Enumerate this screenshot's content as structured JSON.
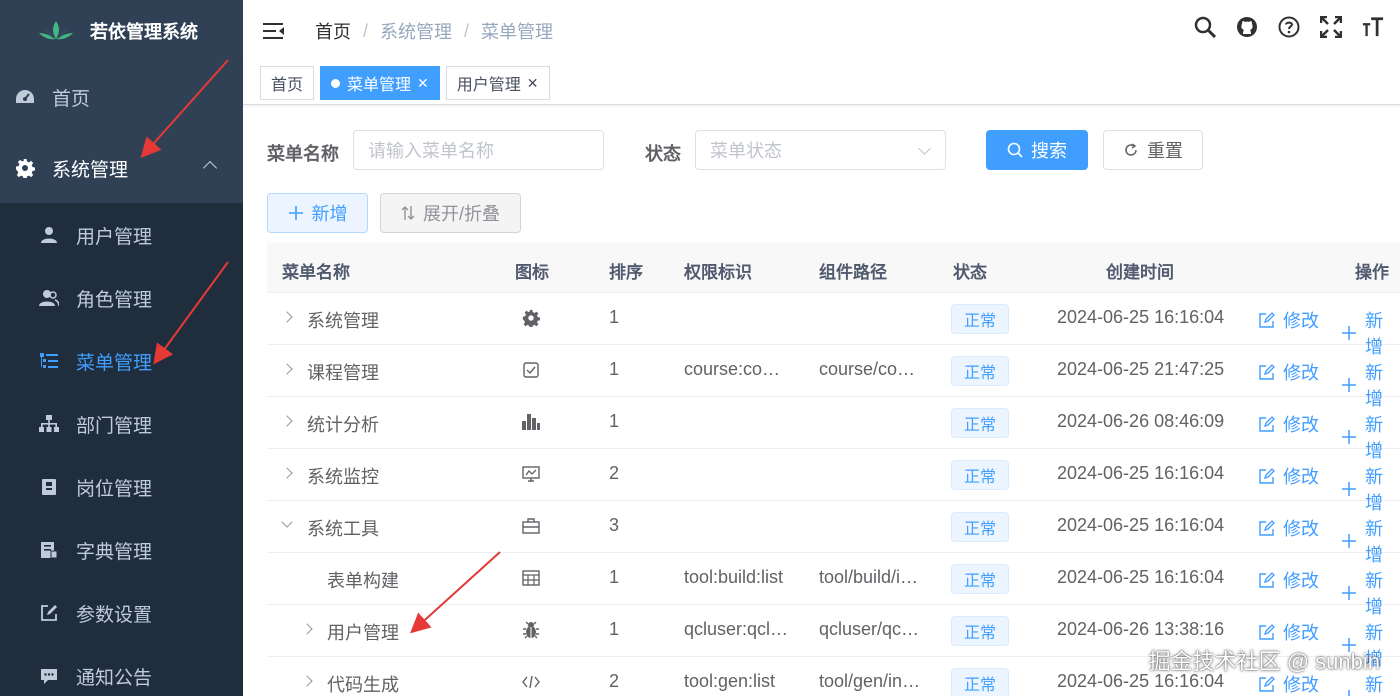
{
  "app": {
    "title": "若依管理系统"
  },
  "sidebar": {
    "items": [
      {
        "label": "首页"
      },
      {
        "label": "系统管理"
      },
      {
        "label": "用户管理"
      },
      {
        "label": "角色管理"
      },
      {
        "label": "菜单管理"
      },
      {
        "label": "部门管理"
      },
      {
        "label": "岗位管理"
      },
      {
        "label": "字典管理"
      },
      {
        "label": "参数设置"
      },
      {
        "label": "通知公告"
      }
    ]
  },
  "breadcrumb": [
    "首页",
    "系统管理",
    "菜单管理"
  ],
  "breadcrumb_sep": "/",
  "tags": [
    {
      "label": "首页"
    },
    {
      "label": "菜单管理"
    },
    {
      "label": "用户管理"
    }
  ],
  "search": {
    "name_label": "菜单名称",
    "name_placeholder": "请输入菜单名称",
    "status_label": "状态",
    "status_placeholder": "菜单状态",
    "search_btn": "搜索",
    "reset_btn": "重置"
  },
  "toolbar": {
    "add_btn": "新增",
    "expand_btn": "展开/折叠"
  },
  "table": {
    "headers": [
      "菜单名称",
      "图标",
      "排序",
      "权限标识",
      "组件路径",
      "状态",
      "创建时间",
      "操作"
    ],
    "rows": [
      {
        "name": "系统管理",
        "icon": "gear-icon",
        "order": "1",
        "perm": "",
        "path": "",
        "status": "正常",
        "created": "2024-06-25 16:16:04",
        "edit": "修改",
        "add": "新增"
      },
      {
        "name": "课程管理",
        "icon": "checkbox-icon",
        "order": "1",
        "perm": "course:co…",
        "path": "course/co…",
        "status": "正常",
        "created": "2024-06-25 21:47:25",
        "edit": "修改",
        "add": "新增"
      },
      {
        "name": "统计分析",
        "icon": "bar-chart-icon",
        "order": "1",
        "perm": "",
        "path": "",
        "status": "正常",
        "created": "2024-06-26 08:46:09",
        "edit": "修改",
        "add": "新增"
      },
      {
        "name": "系统监控",
        "icon": "monitor-icon",
        "order": "2",
        "perm": "",
        "path": "",
        "status": "正常",
        "created": "2024-06-25 16:16:04",
        "edit": "修改",
        "add": "新增"
      },
      {
        "name": "系统工具",
        "icon": "toolbox-icon",
        "order": "3",
        "perm": "",
        "path": "",
        "status": "正常",
        "created": "2024-06-25 16:16:04",
        "edit": "修改",
        "add": "新增"
      },
      {
        "name": "表单构建",
        "icon": "table-icon",
        "order": "1",
        "perm": "tool:build:list",
        "path": "tool/build/i…",
        "status": "正常",
        "created": "2024-06-25 16:16:04",
        "edit": "修改",
        "add": "新增"
      },
      {
        "name": "用户管理",
        "icon": "bug-icon",
        "order": "1",
        "perm": "qcluser:qcl…",
        "path": "qcluser/qc…",
        "status": "正常",
        "created": "2024-06-26 13:38:16",
        "edit": "修改",
        "add": "新增"
      },
      {
        "name": "代码生成",
        "icon": "code-icon",
        "order": "2",
        "perm": "tool:gen:list",
        "path": "tool/gen/in…",
        "status": "正常",
        "created": "2024-06-25 16:16:04",
        "edit": "修改",
        "add": "新增"
      }
    ]
  },
  "watermark": "掘金技术社区 @ sunbin",
  "colors": {
    "sidebar_bg": "#304156",
    "submenu_bg": "#1f2d3d",
    "primary": "#409eff",
    "annotation_arrow": "#e53935"
  }
}
